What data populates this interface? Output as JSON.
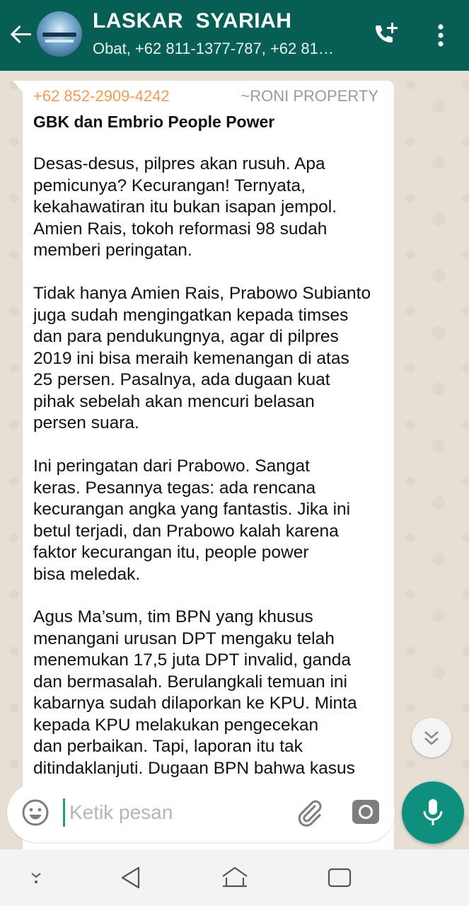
{
  "header": {
    "title": "LASKAR  SYARIAH",
    "subtitle": "Obat, +62 811-1377-787, +62 81…",
    "colors": {
      "bar": "#075e54",
      "accent": "#0f8f7e"
    },
    "icons": {
      "back": "back-arrow-icon",
      "avatar": "group-avatar",
      "add_call": "add-call-icon",
      "more": "more-vert-icon"
    }
  },
  "message": {
    "sender": "+62 852-2909-4242",
    "alias": "~RONI PROPERTY",
    "title": "GBK dan Embrio People Power",
    "paragraphs": [
      "Desas-desus, pilpres akan rusuh. Apa\npemicunya? Kecurangan! Ternyata,\nkekahawatiran itu bukan isapan jempol.\nAmien Rais, tokoh reformasi 98 sudah\nmemberi peringatan.",
      "Tidak hanya Amien Rais, Prabowo Subianto\njuga sudah mengingatkan kepada timses\ndan para pendukungnya, agar di pilpres\n2019 ini bisa meraih kemenangan di atas\n25 persen. Pasalnya, ada dugaan kuat\npihak sebelah akan mencuri belasan\npersen suara.",
      "Ini peringatan dari Prabowo. Sangat\nkeras. Pesannya tegas: ada rencana\nkecurangan angka yang fantastis. Jika ini\nbetul terjadi, dan Prabowo kalah karena\nfaktor kecurangan itu, people power\nbisa meledak.",
      "Agus Ma’sum, tim BPN yang khusus\nmenangani urusan DPT mengaku telah\nmenemukan 17,5 juta DPT invalid, ganda\ndan bermasalah. Berulangkali temuan ini\nkabarnya sudah dilaporkan ke KPU. Minta\nkepada KPU melakukan pengecekan\ndan perbaikan. Tapi, laporan itu tak\nditindaklanjuti. Dugaan BPN bahwa kasus"
    ],
    "colors": {
      "sender": "#f29b5c",
      "alias": "#9a9a9a"
    }
  },
  "composer": {
    "placeholder": "Ketik pesan",
    "value": "",
    "icons": {
      "emoji": "emoji-icon",
      "attach": "paperclip-icon",
      "camera": "camera-icon",
      "mic": "mic-icon",
      "scroll": "scroll-down-icon"
    }
  },
  "system_nav": {
    "icons": [
      "keyboard-hide-icon",
      "back-triangle-icon",
      "home-icon",
      "recents-icon"
    ]
  }
}
